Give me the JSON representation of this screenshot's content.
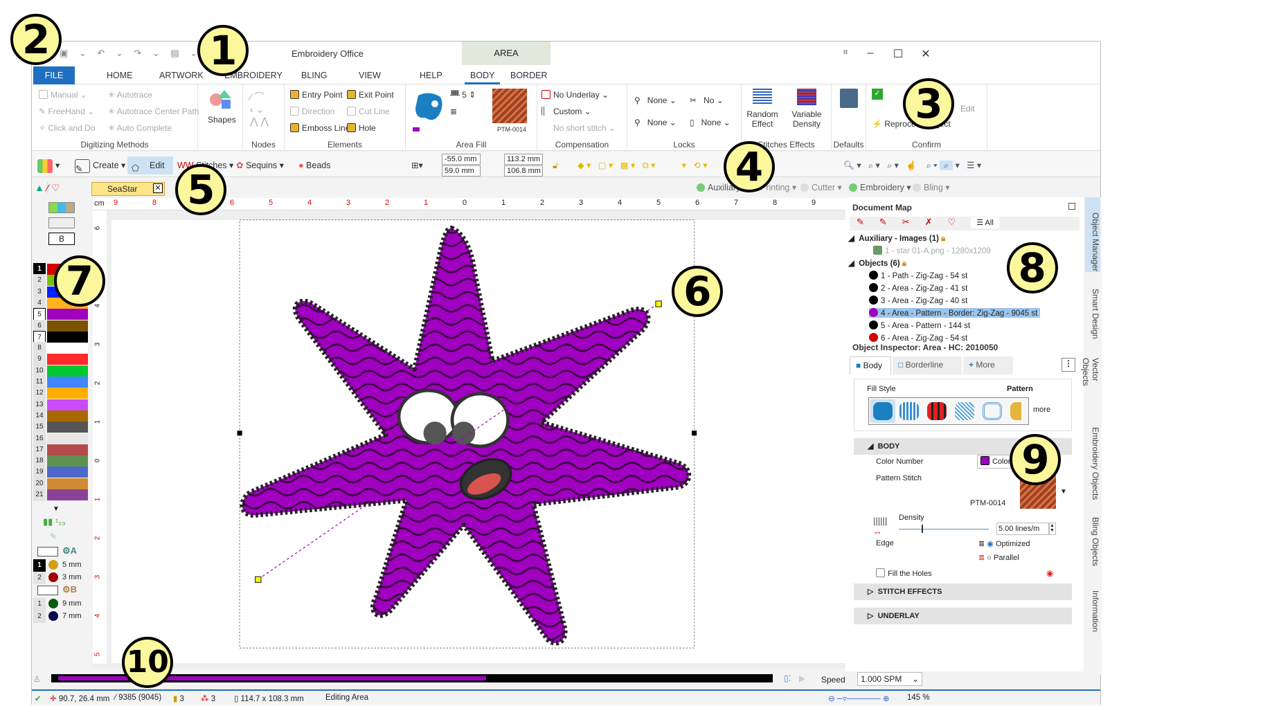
{
  "window": {
    "title": "Embroidery Office",
    "context_tab": "AREA"
  },
  "qat": {
    "icons": [
      "save-icon",
      "undo-icon",
      "redo-icon",
      "paste-icon",
      "process-icon"
    ]
  },
  "ribbon_tabs": [
    "FILE",
    "HOME",
    "ARTWORK",
    "EMBROIDERY",
    "BLING",
    "VIEW",
    "HELP",
    "BODY",
    "BORDER"
  ],
  "active_tab": "BODY",
  "ribbon": {
    "digitizing": {
      "label": "Digitizing Methods",
      "items": [
        "Manual",
        "Autotrace",
        "FreeHand",
        "Autotrace Center Path",
        "Click and Do",
        "Auto Complete"
      ]
    },
    "shapes": {
      "label": "Shapes"
    },
    "nodes": {
      "label": "Nodes"
    },
    "elements": {
      "label": "Elements",
      "items": [
        "Entry Point",
        "Exit Point",
        "Direction",
        "Cut Line",
        "Emboss Line",
        "Hole"
      ]
    },
    "area_fill": {
      "label": "Area Fill",
      "count": "5",
      "pattern": "PTM-0014"
    },
    "compensation": {
      "label": "Compensation",
      "items": [
        "No Underlay",
        "Custom",
        "No short stitch"
      ]
    },
    "locks": {
      "label": "Locks",
      "items": [
        "None",
        "No",
        "None",
        "None"
      ]
    },
    "effects": {
      "label": "Stitches Effects",
      "items": [
        "Random Effect",
        "Variable Density"
      ]
    },
    "defaults": {
      "label": "Defaults"
    },
    "confirm": {
      "label": "Confirm",
      "items": [
        "Edit",
        "Reprocess Object"
      ]
    }
  },
  "toolbar": {
    "create": "Create",
    "edit": "Edit",
    "stitches": "Stitches",
    "sequins": "Sequins",
    "beads": "Beads",
    "x": "-55.0 mm",
    "y": "59.0 mm",
    "w": "113.2 mm",
    "h": "106.8 mm"
  },
  "document_tab": "SeaStar",
  "layers": [
    {
      "label": "Auxiliary",
      "on": true
    },
    {
      "label": "Printing",
      "on": false
    },
    {
      "label": "Cutter",
      "on": false
    },
    {
      "label": "Embroidery",
      "on": true
    },
    {
      "label": "Bling",
      "on": false
    }
  ],
  "ruler": {
    "unit": "cm",
    "top": [
      "9",
      "8",
      "7",
      "6",
      "5",
      "4",
      "3",
      "2",
      "1",
      "0",
      "1",
      "2",
      "3",
      "4",
      "5",
      "6",
      "7",
      "8",
      "9"
    ],
    "left": [
      "6",
      "5",
      "4",
      "3",
      "2",
      "1",
      "0",
      "1",
      "2",
      "3",
      "4",
      "5"
    ]
  },
  "palette": {
    "button": "B",
    "colors": [
      "#d40000",
      "#7ac200",
      "#0022ff",
      "#ffb21a",
      "#a000c0",
      "#7a5200",
      "#000000",
      "#ffffff",
      "#ff2a2a",
      "#00c832",
      "#3f86ff",
      "#ffae00",
      "#c94cff",
      "#a86a00",
      "#555555",
      "#e6e6e6",
      "#b34b4b",
      "#5e9150",
      "#4d68cc",
      "#cf8a32",
      "#8a4399"
    ],
    "sequins_a": {
      "label": "A",
      "items": [
        {
          "n": "1",
          "size": "5 mm",
          "color": "#d4a012"
        },
        {
          "n": "2",
          "size": "3 mm",
          "color": "#a00000"
        }
      ]
    },
    "sequins_b": {
      "label": "B",
      "items": [
        {
          "n": "1",
          "size": "9 mm",
          "color": "#0a5a10"
        },
        {
          "n": "2",
          "size": "7 mm",
          "color": "#0a0a50"
        }
      ]
    }
  },
  "document_map": {
    "title": "Document Map",
    "all": "All",
    "aux": "Auxiliary - Images (1)",
    "aux_item": "1 - star 01-A.png - 1280x1209",
    "objects": "Objects (6)",
    "items": [
      {
        "label": "1 - Path - Zig-Zag - 54 st",
        "color": "#000000"
      },
      {
        "label": "2 - Area - Zig-Zag - 41 st",
        "color": "#000000"
      },
      {
        "label": "3 - Area - Zig-Zag - 40 st",
        "color": "#000000"
      },
      {
        "label": "4 - Area - Pattern - Border: Zig-Zag - 9045 st",
        "color": "#a000c0",
        "selected": true
      },
      {
        "label": "5 - Area - Pattern - 144 st",
        "color": "#000000"
      },
      {
        "label": "6 - Area - Zig-Zag - 54 st",
        "color": "#d40000"
      }
    ]
  },
  "inspector": {
    "title": "Object Inspector: Area - HC: 2010050",
    "tabs": [
      "Body",
      "Borderline",
      "More"
    ],
    "fill_style": "Fill Style",
    "fill_value": "Pattern",
    "more": "more",
    "body": "BODY",
    "color_number": "Color Number",
    "color_value": "Color 5",
    "color_hex": "#a000c0",
    "pattern_stitch": "Pattern Stitch",
    "pattern": "PTM-0014",
    "density": "Density",
    "density_value": "5.00 lines/m",
    "edge": "Edge",
    "optimized": "Optimized",
    "parallel": "Parallel",
    "fill_holes": "Fill the Holes",
    "stitch_effects": "STITCH EFFECTS",
    "underlay": "UNDERLAY"
  },
  "side_tabs": [
    "Object Manager",
    "Smart Design",
    "Vector Objects",
    "Embroidery Objects",
    "Bling Objects",
    "Information"
  ],
  "timeline": {
    "speed_label": "Speed",
    "speed": "1.000 SPM",
    "progress": 0.6
  },
  "status": {
    "coords": "90.7, 26.4 mm",
    "stitches": "9385 (9045)",
    "colors": "3",
    "stops": "3",
    "size": "114.7 x 108.3 mm",
    "mode": "Editing Area",
    "zoom": "145 %"
  },
  "callouts": [
    "1",
    "2",
    "3",
    "4",
    "5",
    "6",
    "7",
    "8",
    "9",
    "10"
  ]
}
